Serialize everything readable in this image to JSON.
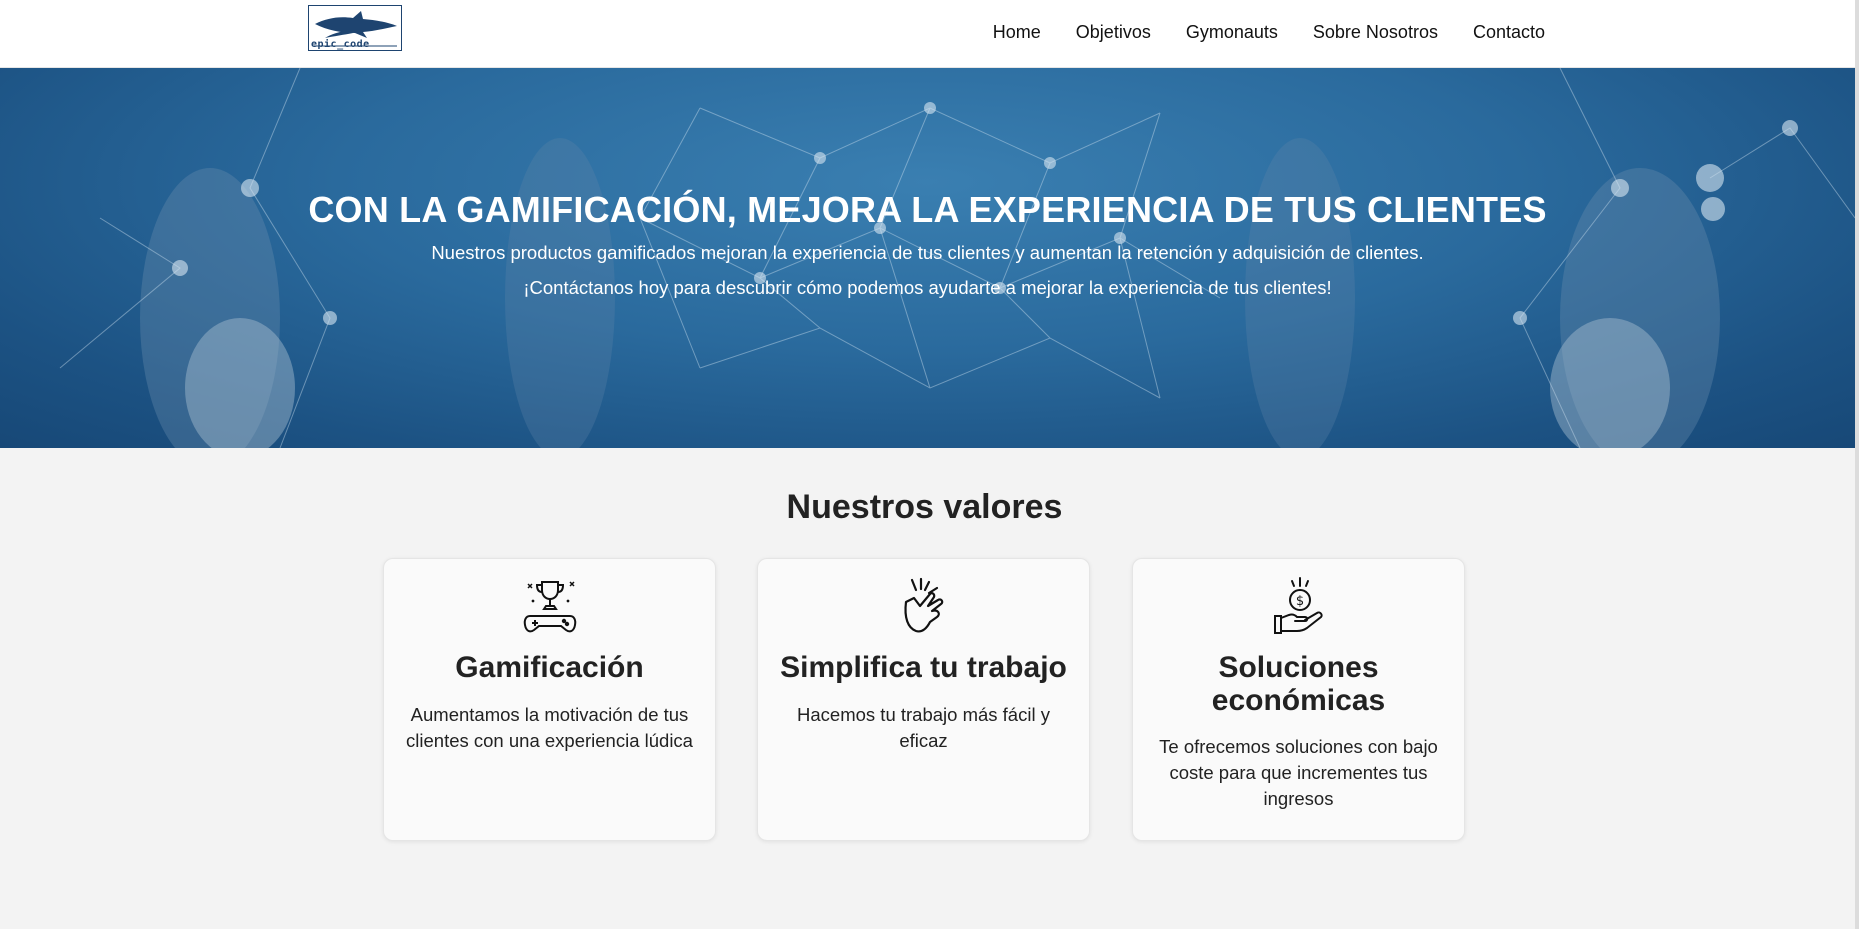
{
  "brand": {
    "logo_text": "epic_code"
  },
  "nav": {
    "items": [
      {
        "label": "Home"
      },
      {
        "label": "Objetivos"
      },
      {
        "label": "Gymonauts"
      },
      {
        "label": "Sobre Nosotros"
      },
      {
        "label": "Contacto"
      }
    ]
  },
  "hero": {
    "title": "CON LA GAMIFICACIÓN, MEJORA LA EXPERIENCIA DE TUS CLIENTES",
    "line1": "Nuestros productos gamificados mejoran la experiencia de tus clientes y aumentan la retención y adquisición de clientes.",
    "line2": "¡Contáctanos hoy para descubrir cómo podemos ayudarte a mejorar la experiencia de tus clientes!"
  },
  "values": {
    "title": "Nuestros valores",
    "cards": [
      {
        "icon": "trophy-gamepad-icon",
        "title": "Gamificación",
        "text": "Aumentamos la motivación de tus clientes con una experiencia lúdica"
      },
      {
        "icon": "snap-fingers-icon",
        "title": "Simplifica tu trabajo",
        "text": "Hacemos tu trabajo más fácil y eficaz"
      },
      {
        "icon": "hand-coin-icon",
        "title": "Soluciones económicas",
        "text": "Te ofrecemos soluciones con bajo coste para que incrementes tus ingresos"
      }
    ]
  },
  "colors": {
    "brand": "#1e4470",
    "hero_blue": "#2a6a9d",
    "background": "#f3f3f3",
    "card": "#fafafa"
  }
}
